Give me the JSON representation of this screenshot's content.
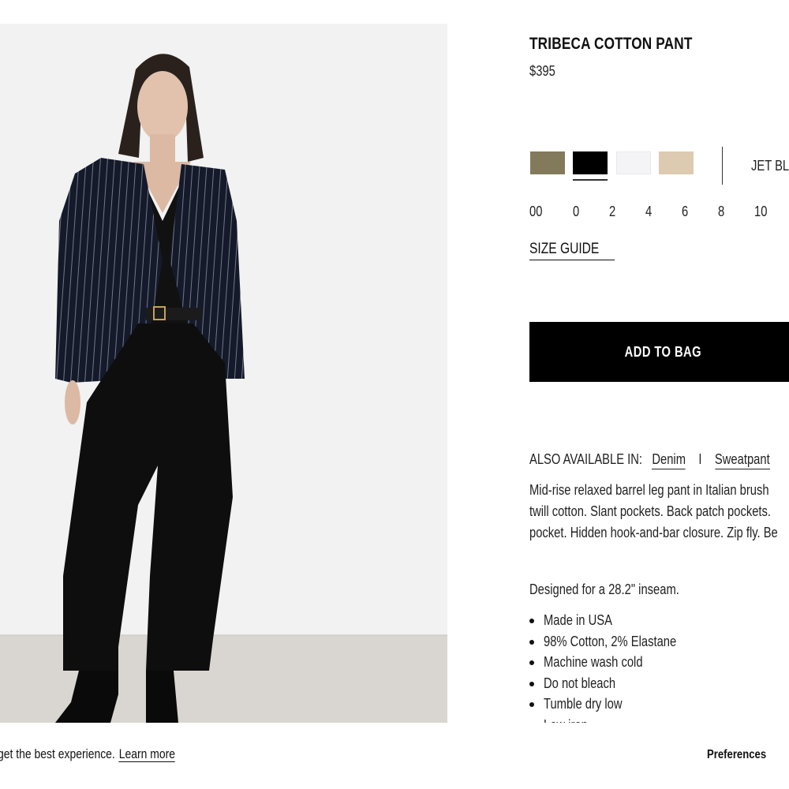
{
  "product": {
    "title": "TRIBECA COTTON PANT",
    "price": "$395",
    "image_alt": "Model wearing pinstripe double-breasted blazer and black barrel leg pants"
  },
  "colors": {
    "swatches": [
      {
        "name": "olive",
        "hex": "#837a5c"
      },
      {
        "name": "jet-black",
        "hex": "#000000",
        "selected": true
      },
      {
        "name": "white",
        "hex": "#f4f4f7"
      },
      {
        "name": "beige",
        "hex": "#dccbb0"
      }
    ],
    "selected_label": "JET BLA"
  },
  "sizes": [
    "00",
    "0",
    "2",
    "4",
    "6",
    "8",
    "10"
  ],
  "size_guide_label": "SIZE GUIDE",
  "add_to_bag_label": "ADD TO BAG",
  "also_available": {
    "label": "ALSO AVAILABLE IN:",
    "links": [
      "Denim",
      "Sweatpant"
    ],
    "separator": "I"
  },
  "description": {
    "lines": [
      "Mid-rise relaxed barrel leg pant in Italian brush",
      "twill cotton. Slant pockets. Back patch pockets.",
      "pocket. Hidden hook-and-bar closure. Zip fly. Be"
    ],
    "inseam": "Designed for a 28.2\" inseam.",
    "details": [
      "Made in USA",
      "98% Cotton, 2% Elastane",
      "Machine wash cold",
      "Do not bleach",
      "Tumble dry low",
      "Low iron"
    ]
  },
  "cookie_bar": {
    "text": "get the best experience.",
    "learn_more": "Learn more",
    "preferences": "Preferences"
  }
}
